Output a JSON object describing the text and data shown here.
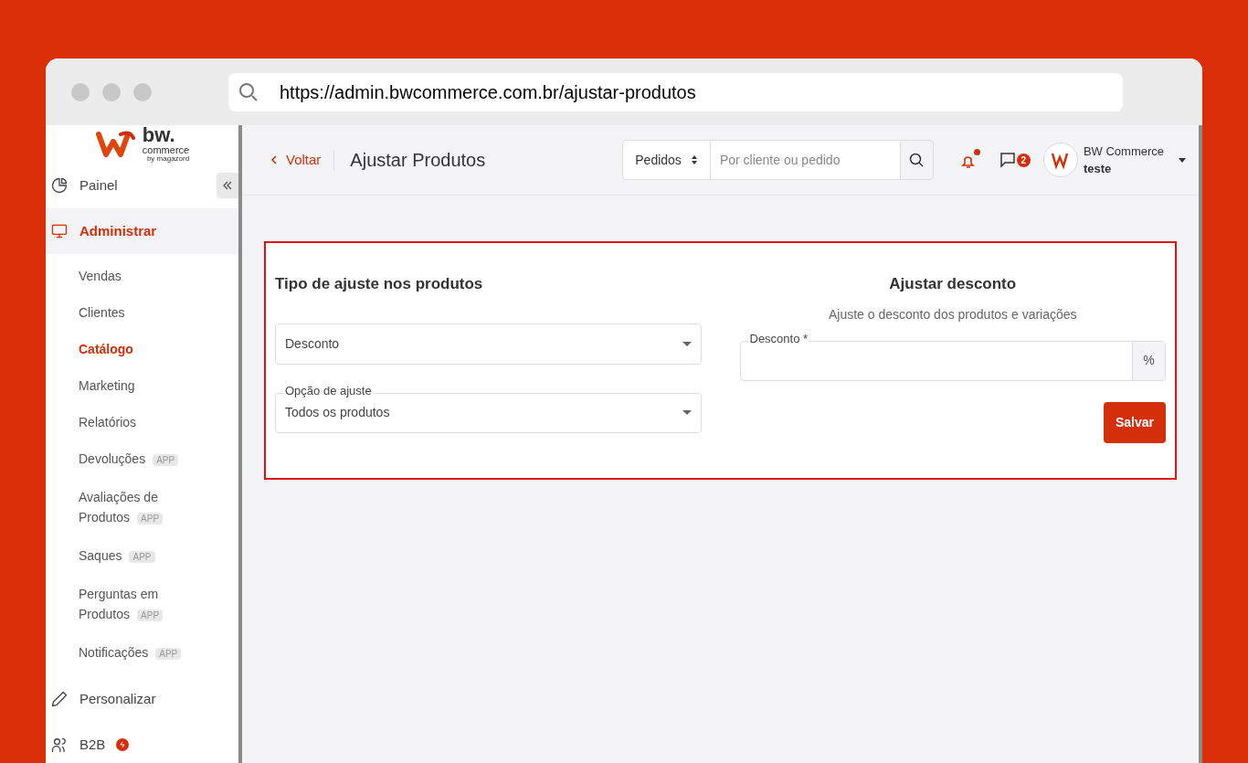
{
  "browser": {
    "url": "https://admin.bwcommerce.com.br/ajustar-produtos"
  },
  "logo": {
    "mark": "bw.",
    "word": "commerce",
    "byline": "by magazord"
  },
  "sidebar": {
    "items": [
      {
        "label": "Painel",
        "selected": false
      },
      {
        "label": "Administrar",
        "selected": true,
        "children": [
          {
            "label": "Vendas",
            "selected": false
          },
          {
            "label": "Clientes",
            "selected": false
          },
          {
            "label": "Catálogo",
            "selected": true
          },
          {
            "label": "Marketing",
            "selected": false
          },
          {
            "label": "Relatórios",
            "selected": false
          },
          {
            "label": "Devoluções",
            "badge": "APP",
            "selected": false
          },
          {
            "label": "Avaliações de Produtos",
            "badge": "APP",
            "selected": false
          },
          {
            "label": "Saques",
            "badge": "APP",
            "selected": false
          },
          {
            "label": "Perguntas em Produtos",
            "badge": "APP",
            "selected": false
          },
          {
            "label": "Notificações",
            "badge": "APP",
            "selected": false
          }
        ]
      },
      {
        "label": "Personalizar",
        "selected": false
      },
      {
        "label": "B2B",
        "selected": false,
        "alert": true
      }
    ]
  },
  "header": {
    "back": "Voltar",
    "title": "Ajustar Produtos",
    "search_scope": "Pedidos",
    "search_placeholder": "Por cliente ou pedido",
    "notification_dot": true,
    "messages_count": "2",
    "user_name": "BW Commerce",
    "user_store": "teste"
  },
  "form": {
    "left_title": "Tipo de ajuste nos produtos",
    "type_select": {
      "value": "Desconto"
    },
    "option_select": {
      "label": "Opção de ajuste",
      "value": "Todos os produtos"
    },
    "right_title": "Ajustar desconto",
    "right_subtitle": "Ajuste o desconto dos produtos e variações",
    "discount": {
      "label": "Desconto *",
      "suffix": "%"
    },
    "save": "Salvar"
  }
}
